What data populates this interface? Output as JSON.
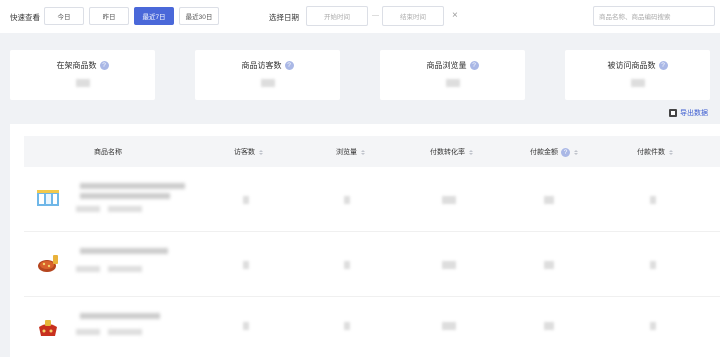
{
  "filter": {
    "quick_label": "快速查看",
    "buttons": [
      "今日",
      "昨日",
      "最近7日",
      "最近30日"
    ],
    "active_index": 2,
    "date_label": "选择日期",
    "start_placeholder": "开始时间",
    "separator": "—",
    "end_placeholder": "结束时间",
    "clear_icon": "×",
    "search_placeholder": "商品名称、商品编码搜索"
  },
  "stats": [
    {
      "title": "在架商品数"
    },
    {
      "title": "商品访客数"
    },
    {
      "title": "商品浏览量"
    },
    {
      "title": "被访问商品数"
    }
  ],
  "export_label": "导出数据",
  "table": {
    "columns": [
      "商品名称",
      "访客数",
      "浏览量",
      "付数转化率",
      "付款金额",
      "付款件数"
    ],
    "rows": 3
  },
  "colors": {
    "accent": "#4a68d9",
    "link": "#3a5bd0"
  }
}
